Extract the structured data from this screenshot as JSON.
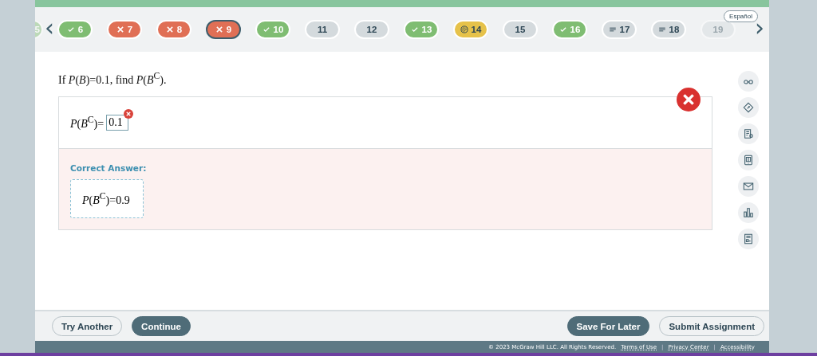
{
  "question_nav": {
    "previous_arrow": "‹",
    "next_arrow": "›",
    "language_button": "Español",
    "items": [
      {
        "label": "5",
        "kind": "correct",
        "selected": false,
        "partial_view": true
      },
      {
        "label": "6",
        "kind": "correct",
        "selected": false,
        "partial_view": false
      },
      {
        "label": "7",
        "kind": "incorrect",
        "selected": false,
        "partial_view": false
      },
      {
        "label": "8",
        "kind": "incorrect",
        "selected": false,
        "partial_view": false
      },
      {
        "label": "9",
        "kind": "incorrect",
        "selected": true,
        "partial_view": false
      },
      {
        "label": "10",
        "kind": "correct",
        "selected": false,
        "partial_view": false
      },
      {
        "label": "11",
        "kind": "unanswered",
        "selected": false,
        "partial_view": false
      },
      {
        "label": "12",
        "kind": "unanswered",
        "selected": false,
        "partial_view": false
      },
      {
        "label": "13",
        "kind": "correct",
        "selected": false,
        "partial_view": false
      },
      {
        "label": "14",
        "kind": "partial",
        "selected": false,
        "partial_view": false
      },
      {
        "label": "15",
        "kind": "unanswered",
        "selected": false,
        "partial_view": false
      },
      {
        "label": "16",
        "kind": "correct",
        "selected": false,
        "partial_view": false
      },
      {
        "label": "17",
        "kind": "started",
        "selected": false,
        "partial_view": false
      },
      {
        "label": "18",
        "kind": "started",
        "selected": false,
        "partial_view": false
      },
      {
        "label": "19",
        "kind": "unanswered",
        "selected": false,
        "partial_view": true
      }
    ]
  },
  "question": {
    "prompt": "If *P*(*B*)=0.1, find *P*(*B*$^{C}$).",
    "result_correct": false,
    "answer_label": "*P*(*B*$^{C}$)=",
    "answer_value": "0.1",
    "answer_wrong": true,
    "correct_answer_heading": "Correct Answer:",
    "correct_answer": "*P*(*B*$^{C}$)=0.9"
  },
  "tools": [
    {
      "kind": "glasses"
    },
    {
      "kind": "tag"
    },
    {
      "kind": "hint"
    },
    {
      "kind": "ebook"
    },
    {
      "kind": "mail"
    },
    {
      "kind": "chart"
    },
    {
      "kind": "report"
    }
  ],
  "footer": {
    "buttons": [
      {
        "label": "Try Another",
        "kind": "outline"
      },
      {
        "label": "Continue",
        "kind": "dark"
      },
      {
        "label": "Save For Later",
        "kind": "dark"
      },
      {
        "label": "Submit Assignment",
        "kind": "outline"
      }
    ],
    "copyright": "© 2023 McGraw Hill LLC. All Rights Reserved.",
    "legal_items": [
      {
        "kind": "link",
        "text": "Terms of Use"
      },
      {
        "kind": "separator",
        "text": "|"
      },
      {
        "kind": "link",
        "text": "Privacy Center"
      },
      {
        "kind": "separator",
        "text": "|"
      },
      {
        "kind": "link",
        "text": "Accessibility"
      }
    ]
  }
}
